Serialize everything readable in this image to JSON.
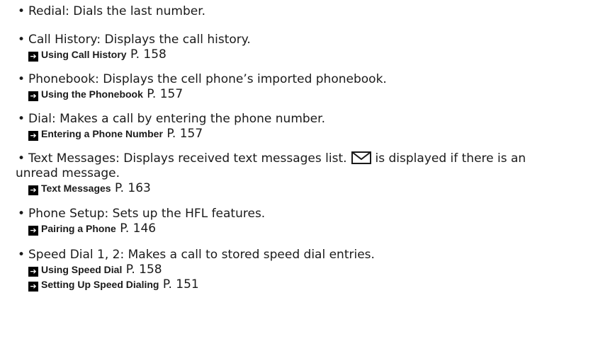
{
  "items": [
    {
      "term": "Redial",
      "description": ": Dials the last number.",
      "refs": []
    },
    {
      "term": "Call History",
      "description": ": Displays the call history.",
      "refs": [
        {
          "title": "Using Call History",
          "page": "P. 158"
        }
      ]
    },
    {
      "term": "Phonebook",
      "description": ": Displays the cell phone’s imported phonebook.",
      "refs": [
        {
          "title": "Using the Phonebook",
          "page": "P. 157"
        }
      ]
    },
    {
      "term": "Dial",
      "description": ": Makes a call by entering the phone number.",
      "refs": [
        {
          "title": "Entering a Phone Number",
          "page": "P. 157"
        }
      ]
    },
    {
      "term": "Text Messages",
      "description": ": Displays received text messages list.",
      "description_after_icon": "is displayed if there is an",
      "description_line2": "unread message.",
      "icon": "envelope-icon",
      "refs": [
        {
          "title": "Text Messages",
          "page": "P. 163"
        }
      ]
    },
    {
      "term": "Phone Setup",
      "description": ": Sets up the HFL features.",
      "refs": [
        {
          "title": "Pairing a Phone",
          "page": "P. 146"
        }
      ]
    },
    {
      "term": "Speed Dial 1, 2",
      "description": ": Makes a call to stored speed dial entries.",
      "refs": [
        {
          "title": "Using Speed Dial",
          "page": "P. 158"
        },
        {
          "title": "Setting Up Speed Dialing",
          "page": "P. 151"
        }
      ]
    }
  ]
}
